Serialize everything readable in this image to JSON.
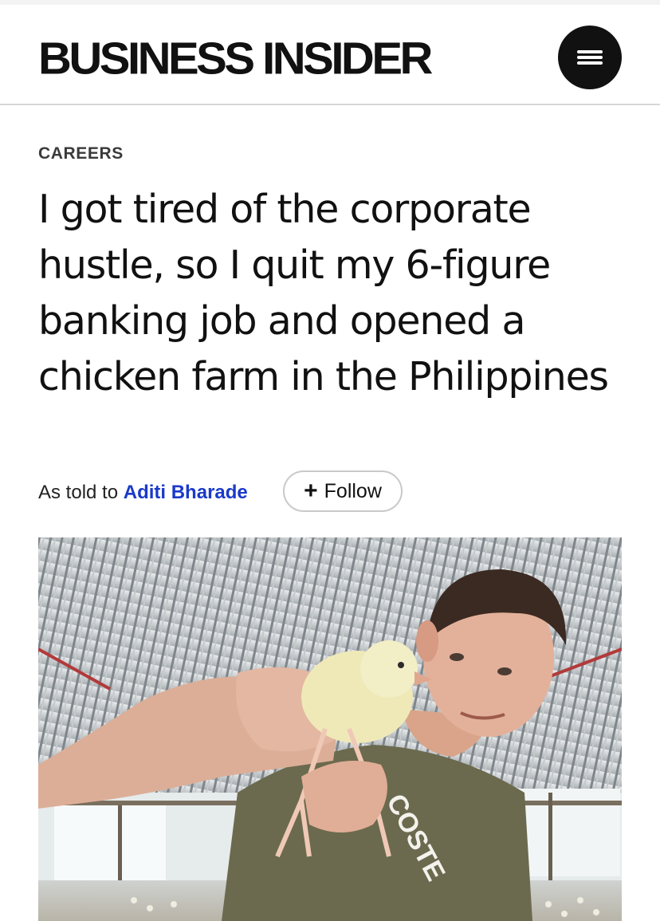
{
  "header": {
    "logo_text": "BUSINESS INSIDER",
    "menu_icon": "hamburger-menu-icon"
  },
  "article": {
    "category": "CAREERS",
    "headline": "I got tired of the corporate hustle, so I quit my 6-figure banking job and opened a chicken farm in the Philippines",
    "byline_prefix": "As told to",
    "author": "Aditi Bharade",
    "follow_label": "Follow",
    "follow_icon": "plus-icon",
    "shirt_text": "COSTE"
  },
  "colors": {
    "author_link": "#1a39c9",
    "text": "#111111",
    "menu_button": "#111111"
  }
}
